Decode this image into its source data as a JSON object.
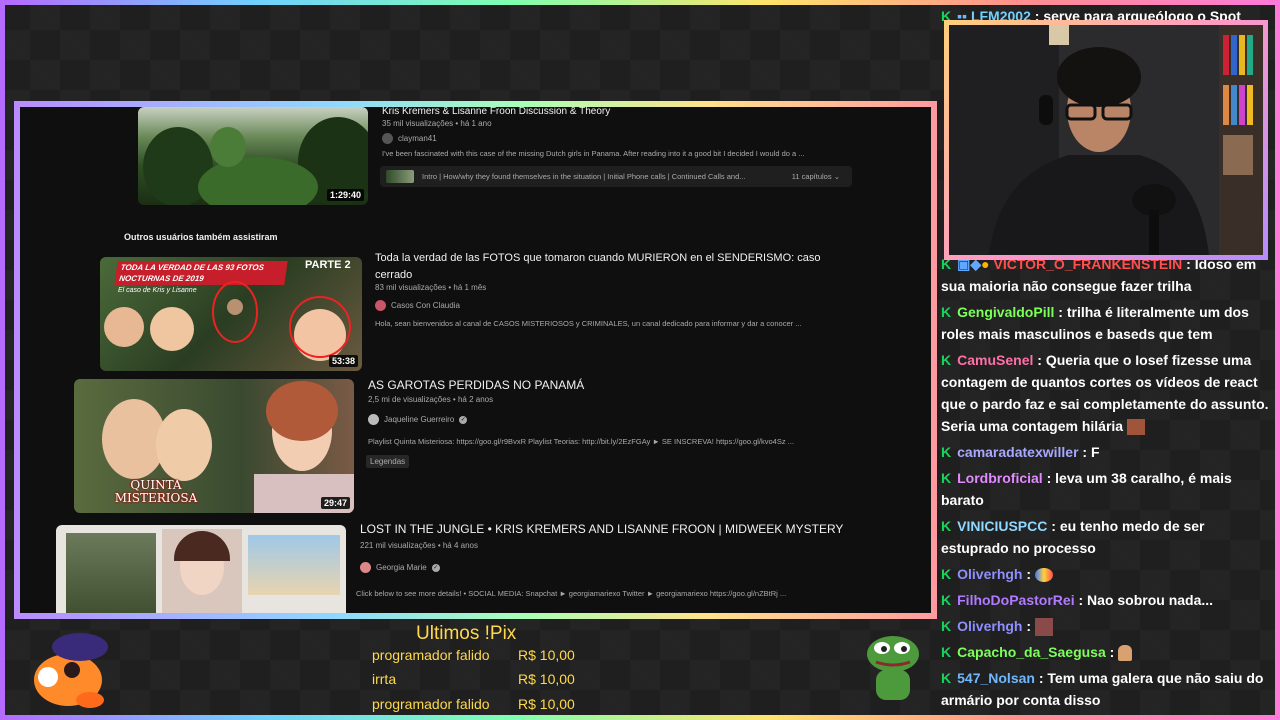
{
  "stream": {
    "accent_gradient": [
      "#b56bff",
      "#6fd1ff",
      "#7fffb0",
      "#ffe46b",
      "#ff8f8f"
    ]
  },
  "youtube": {
    "section_title": "Outros usuários também assistiram",
    "videos": [
      {
        "title": "Kris Kremers & Lisanne Froon Discussion & Theory",
        "meta": "35 mil visualizações • há 1 ano",
        "channel": "clayman41",
        "description": "I've been fascinated with this case of the missing Dutch girls in Panama. After reading into it a good bit I decided I would do a ...",
        "duration": "1:29:40",
        "chapters_text": "Intro | How/why they found themselves in the situation | Initial Phone calls | Continued Calls and...",
        "chapters_count": "11 capítulos"
      },
      {
        "title": "Toda la verdad de las FOTOS que tomaron cuando MURIERON en el SENDERISMO: caso cerrado",
        "meta": "83 mil visualizações • há 1 mês",
        "channel": "Casos Con Claudia",
        "description": "Hola, sean bienvenidos al canal de CASOS MISTERIOSOS y CRIMINALES, un canal dedicado para informar y dar a conocer ...",
        "duration": "53:38",
        "thumb_text_top": "TODA LA VERDAD DE LAS 93 FOTOS NOCTURNAS DE 2019",
        "thumb_text_part": "PARTE 2",
        "thumb_text_case": "El caso de Kris y Lisanne"
      },
      {
        "title": "AS GAROTAS PERDIDAS NO PANAMÁ",
        "meta": "2,5 mi de visualizações • há 2 anos",
        "channel": "Jaqueline Guerreiro",
        "description": "Playlist Quinta Misteriosa: https://goo.gl/r9BvxR Playlist Teorias: http://bit.ly/2EzFGAy ► SE INSCREVA! https://goo.gl/kvo4Sz ...",
        "duration": "29:47",
        "tag": "Legendas",
        "thumb_text": "QUINTA MISTERIOSA"
      },
      {
        "title": "LOST IN THE JUNGLE • KRIS KREMERS AND LISANNE FROON | MIDWEEK MYSTERY",
        "meta": "221 mil visualizações • há 4 anos",
        "channel": "Georgia Marie",
        "description": "Click below to see more details! • SOCIAL MEDIA: Snapchat ► georgiamariexo Twitter ► georgiamariexo https://goo.gl/nZBtRj ..."
      }
    ]
  },
  "pix": {
    "title": "Ultimos !Pix",
    "donations": [
      {
        "name": "programador falido",
        "amount": "R$ 10,00"
      },
      {
        "name": "irrta",
        "amount": "R$ 10,00"
      },
      {
        "name": "programador falido",
        "amount": "R$ 10,00"
      }
    ]
  },
  "chat": {
    "messages": [
      {
        "user": "LFM2002",
        "color": "#6fd1ff",
        "text": "serve para arqueólogo o Spot"
      },
      {
        "user": "VICTOR_O_FRANKENSTEIN",
        "color": "#ff4f4f",
        "text": "Idoso em sua maioria não consegue fazer trilha"
      },
      {
        "user": "GengivaldoPill",
        "color": "#7dff5a",
        "text": "trilha é literalmente um dos roles mais masculinos e baseds que tem"
      },
      {
        "user": "CamuSenel",
        "color": "#ff6fa8",
        "text": "Queria que o Iosef fizesse uma contagem de quantos cortes os vídeos de react que o pardo faz e sai completamente do assunto. Seria uma contagem hilária"
      },
      {
        "user": "camaradatexwiller",
        "color": "#a8a8ff",
        "text": "F"
      },
      {
        "user": "Lordbroficial",
        "color": "#e28aff",
        "text": "leva um 38 caralho, é mais barato"
      },
      {
        "user": "VINICIUSPCC",
        "color": "#8fd8ff",
        "text": "eu tenho medo de ser estuprado no processo"
      },
      {
        "user": "Oliverhgh",
        "color": "#8f8fff",
        "text": ""
      },
      {
        "user": "FilhoDoPastorRei",
        "color": "#b07bff",
        "text": "Nao sobrou nada..."
      },
      {
        "user": "Oliverhgh",
        "color": "#8f8fff",
        "text": ""
      },
      {
        "user": "Capacho_da_Saegusa",
        "color": "#7dff5a",
        "text": ""
      },
      {
        "user": "547_Nolsan",
        "color": "#6fb8ff",
        "text": "Tem uma galera que não saiu do armário por conta disso"
      }
    ]
  }
}
